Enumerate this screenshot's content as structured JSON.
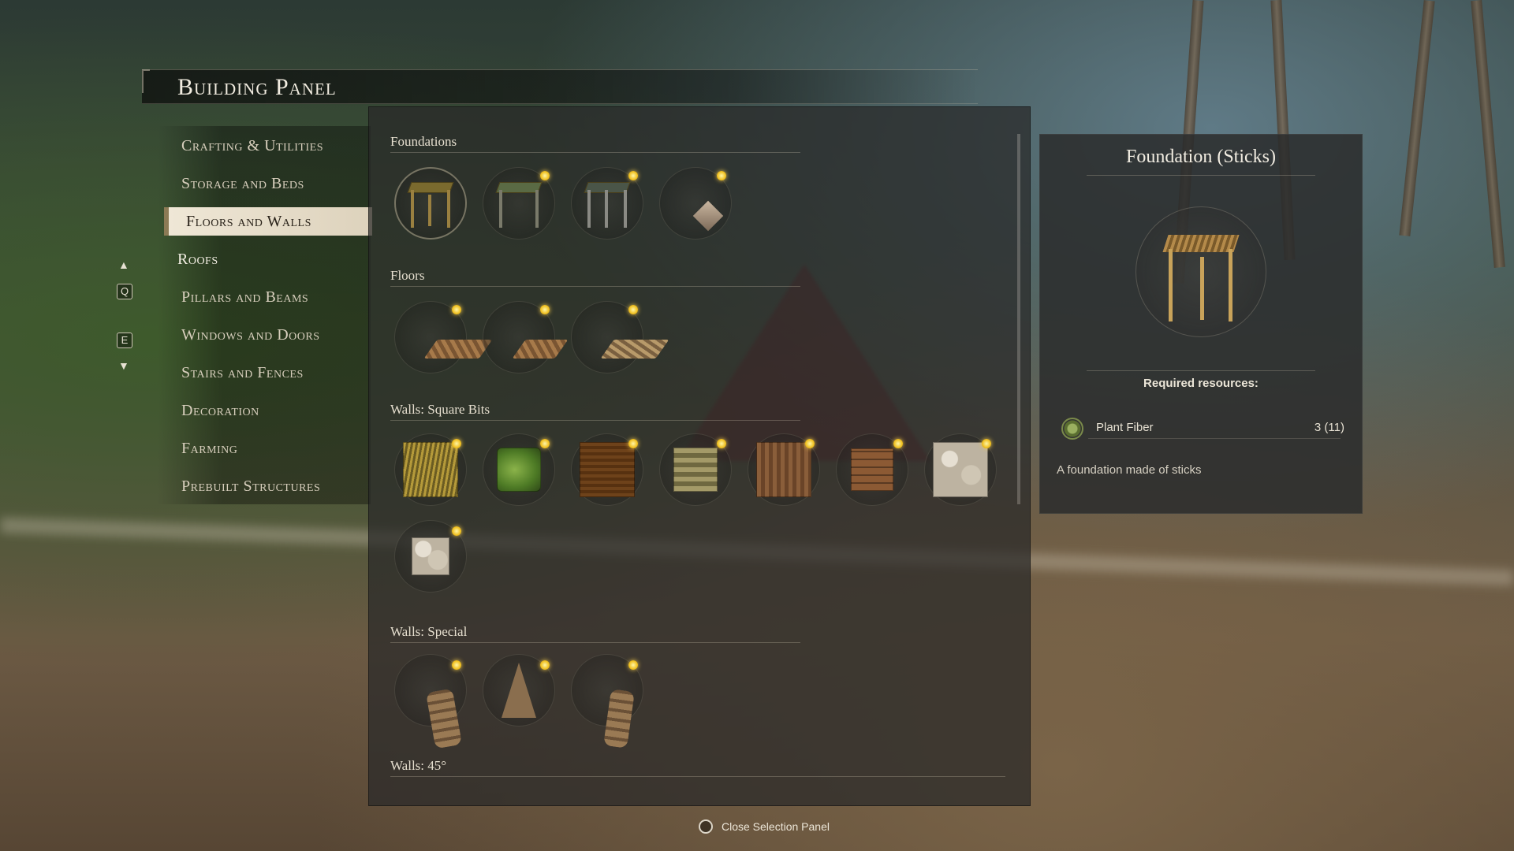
{
  "panel": {
    "title": "Building Panel"
  },
  "categories": [
    "Crafting & Utilities",
    "Storage and Beds",
    "Floors and Walls",
    "Roofs",
    "Pillars and Beams",
    "Windows and Doors",
    "Stairs and Fences",
    "Decoration",
    "Farming",
    "Prebuilt Structures"
  ],
  "active_category": "Floors and Walls",
  "nav": {
    "prev_key": "Q",
    "next_key": "E",
    "up_icon": "triangle-up-icon",
    "down_icon": "triangle-down-icon"
  },
  "sections": {
    "foundations": "Foundations",
    "floors": "Floors",
    "walls_square": "Walls: Square Bits",
    "walls_special": "Walls: Special",
    "walls_45": "Walls: 45°"
  },
  "detail": {
    "title": "Foundation (Sticks)",
    "required_label": "Required resources:",
    "resource_name": "Plant Fiber",
    "resource_count": "3 (11)",
    "description": "A foundation made of sticks"
  },
  "hint": {
    "label": "Close Selection Panel",
    "icon": "mouse-right-icon"
  },
  "colors": {
    "new_badge": "#f2c94c",
    "active_tab_bg": "#efe7d6"
  }
}
